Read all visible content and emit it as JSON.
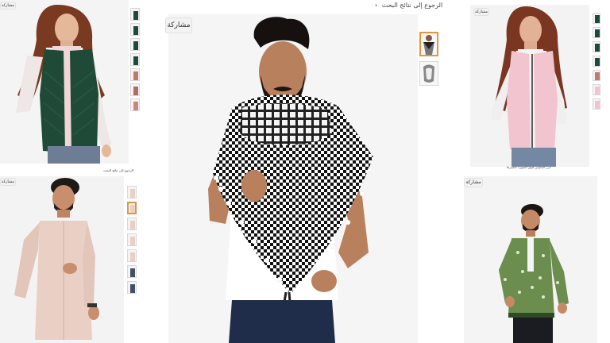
{
  "main_panel": {
    "back_link": "الرجوع إلى نتائج البحث",
    "back_chevron": "‹",
    "share_label": "مشاركة",
    "thumbnails": [
      "shemagh-model-icon",
      "scarf-folded-icon"
    ],
    "active_thumbnail": 0
  },
  "top_left_panel": {
    "share_label": "مشاركة",
    "thumbnail_count": 7
  },
  "top_right_panel": {
    "share_label": "مشاركة",
    "caption": "مرر الماوس فوق الصورة لتكبيرها",
    "thumbnail_count": 7
  },
  "bottom_left_panel": {
    "share_label": "مشاركة",
    "back_link": "الرجوع إلى نتائج البحث",
    "thumbnail_count": 7
  },
  "bottom_right_panel": {
    "share_label": "مشاركة"
  },
  "colors": {
    "vest_green": "#1f4a37",
    "vest_pink": "#f2c4cf",
    "shirt_beige": "#e9cfc4",
    "jacket_green": "#6b8d4e",
    "active_thumb_border": "#e3963e"
  }
}
